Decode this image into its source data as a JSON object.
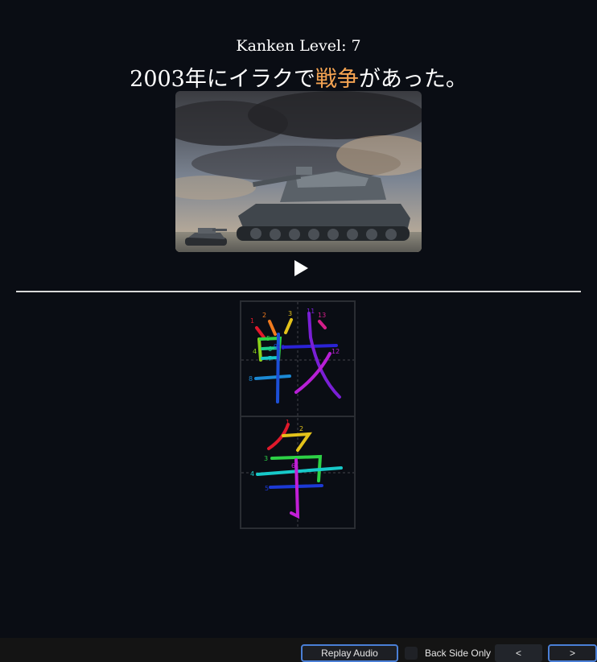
{
  "card": {
    "level_text": "Kanken Level: 7",
    "sentence_before": "2003年にイラクで",
    "sentence_highlight": "戦争",
    "sentence_after": "があった。",
    "highlight_color": "#f5a452"
  },
  "image": {
    "subject": "tank-photo"
  },
  "audio": {
    "play_icon": "play-icon"
  },
  "stroke_order": {
    "kanji": [
      {
        "char": "戦",
        "stroke_count": 13,
        "numbers": [
          "1",
          "2",
          "3",
          "4",
          "5",
          "6",
          "7",
          "8",
          "9",
          "10",
          "11",
          "12",
          "13"
        ]
      },
      {
        "char": "争",
        "stroke_count": 6,
        "numbers": [
          "1",
          "2",
          "3",
          "4",
          "5",
          "6"
        ]
      }
    ]
  },
  "toolbar": {
    "replay_label": "Replay Audio",
    "back_side_label": "Back Side Only",
    "prev_label": "<",
    "next_label": ">",
    "accent_color": "#4a7fd6"
  }
}
